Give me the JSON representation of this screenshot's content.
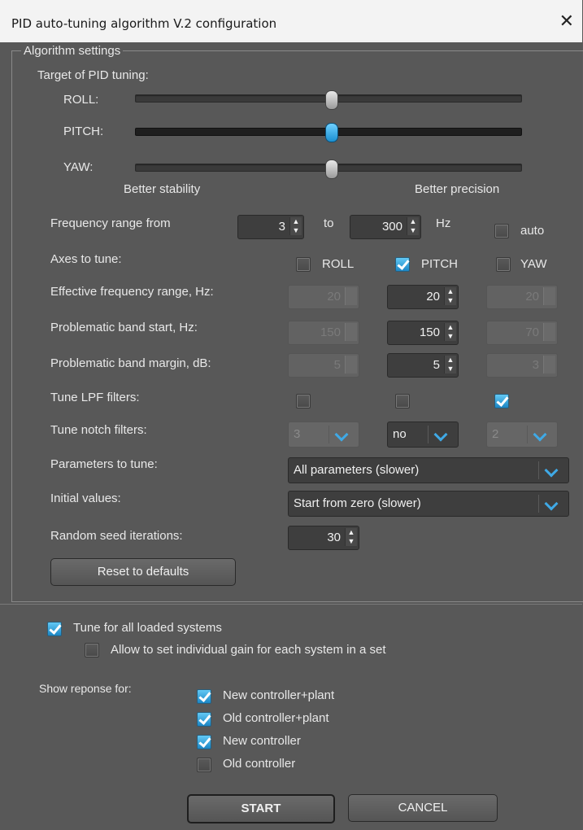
{
  "window": {
    "title": "PID auto-tuning algorithm V.2 configuration",
    "close": "✕"
  },
  "algorithm": {
    "group_label": "Algorithm settings",
    "target_label": "Target of PID tuning:",
    "sliders": [
      {
        "label": "ROLL:",
        "level": 0.5
      },
      {
        "label": "PITCH:",
        "level": 0.5
      },
      {
        "label": "YAW:",
        "level": 0.5
      }
    ],
    "better_stability": "Better stability",
    "better_precision": "Better precision",
    "freq_from_label": "Frequency range from",
    "freq_from": "3",
    "freq_to_label": "to",
    "freq_to": "300",
    "freq_unit": "Hz",
    "auto_label": "auto",
    "axes_label": "Axes to tune:",
    "axes": [
      {
        "label": "ROLL",
        "checked": false
      },
      {
        "label": "PITCH",
        "checked": true
      },
      {
        "label": "YAW",
        "checked": false
      }
    ],
    "eff_freq_label": "Effective frequency range, Hz:",
    "eff_freq": [
      "20",
      "20",
      "20"
    ],
    "band_start_label": "Problematic band start, Hz:",
    "band_start": [
      "150",
      "150",
      "70"
    ],
    "band_margin_label": "Problematic band margin, dB:",
    "band_margin": [
      "5",
      "5",
      "3"
    ],
    "lpf_label": "Tune LPF filters:",
    "lpf": [
      false,
      false,
      true
    ],
    "notch_label": "Tune notch filters:",
    "notch": [
      "3",
      "no",
      "2"
    ],
    "params_label": "Parameters to tune:",
    "params_value": "All parameters (slower)",
    "initial_label": "Initial values:",
    "initial_value": "Start from zero (slower)",
    "seed_label": "Random seed iterations:",
    "seed_value": "30",
    "reset_label": "Reset to defaults"
  },
  "options": {
    "tune_all_label": "Tune for all loaded systems",
    "tune_all": true,
    "individual_gain_label": "Allow to set individual gain for each system in a set",
    "individual_gain": false,
    "show_response_label": "Show reponse for:",
    "responses": [
      {
        "label": "New controller+plant",
        "checked": true
      },
      {
        "label": "Old controller+plant",
        "checked": true
      },
      {
        "label": "New controller",
        "checked": true
      },
      {
        "label": "Old controller",
        "checked": false
      }
    ]
  },
  "buttons": {
    "start": "START",
    "cancel": "CANCEL"
  },
  "colors": {
    "accent": "#1b86c4",
    "background": "#585858",
    "titlebar": "#f3f3f3"
  }
}
